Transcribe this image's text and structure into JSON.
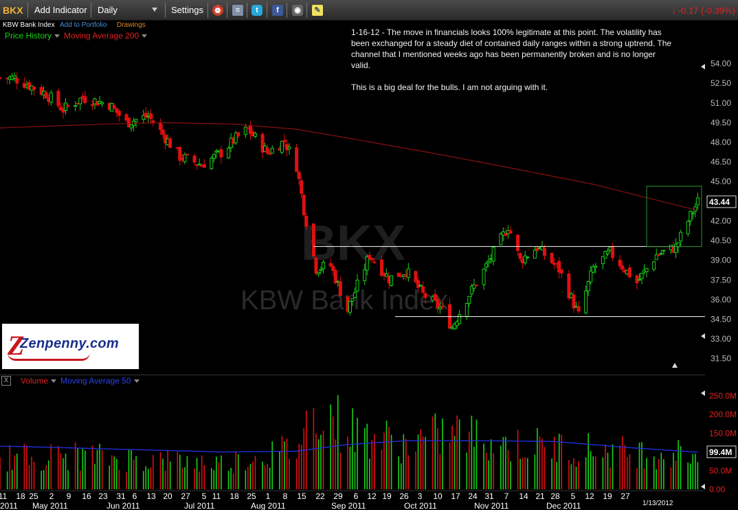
{
  "toolbar": {
    "symbol": "BKX",
    "add_indicator": "Add Indicator",
    "period": "Daily",
    "settings": "Settings",
    "change_arrow": "↓",
    "change": "-0.17 (-0.39%)",
    "icons": [
      "alarm-clock-icon",
      "database-icon",
      "twitter-icon",
      "facebook-icon",
      "camera-icon",
      "sticky-note-icon"
    ]
  },
  "subbar": {
    "name": "KBW Bank Index",
    "add_to_portfolio": "Add to Portfolio",
    "drawings": "Drawings"
  },
  "price_legend": {
    "price_history": "Price History",
    "moving_average": "Moving Average 200"
  },
  "volume_legend": {
    "close": "X",
    "volume": "Volume",
    "moving_average": "Moving Average 50"
  },
  "note": {
    "paragraph_1": "1-16-12 - The move in financials looks 100% legitimate at this point. The volatility has been exchanged for a steady diet of contained daily ranges within a strong uptrend. The channel that I mentioned weeks ago has been permanently broken and is no longer valid.",
    "paragraph_2": "This is a big deal for the bulls. I am not arguing with it."
  },
  "logo": {
    "text": "Zenpenny.com"
  },
  "watermark": {
    "symbol": "BKX",
    "name": "KBW Bank Index"
  },
  "colors": {
    "up": "#18d418",
    "down": "#e01010",
    "ma200": "#8a1010",
    "ma50": "#2030d8",
    "annotation_lines": "#ffffff",
    "highlight_box": "#2a9a2a",
    "symbol_accent": "#f2b233"
  },
  "chart_data": [
    {
      "type": "candlestick",
      "series": [
        {
          "name": "Price History"
        },
        {
          "name": "Moving Average 200"
        }
      ],
      "y_ticks": [
        "54.00",
        "52.50",
        "51.00",
        "49.50",
        "48.00",
        "46.50",
        "45.00",
        "43.44",
        "42.00",
        "40.50",
        "39.00",
        "37.50",
        "36.00",
        "34.50",
        "33.00",
        "31.50"
      ],
      "ylim": [
        30.75,
        55.5
      ],
      "last_price": 43.44,
      "x_ticks": [
        "11",
        "18",
        "25",
        "2",
        "9",
        "16",
        "23",
        "31",
        "6",
        "13",
        "20",
        "27",
        "5",
        "11",
        "18",
        "25",
        "1",
        "8",
        "15",
        "22",
        "29",
        "6",
        "12",
        "19",
        "26",
        "3",
        "10",
        "17",
        "24",
        "31",
        "7",
        "14",
        "21",
        "28",
        "5",
        "12",
        "19",
        "27"
      ],
      "month_labels": [
        "2011",
        "May 2011",
        "Jun 2011",
        "Jul 2011",
        "Aug 2011",
        "Sep 2011",
        "Oct 2011",
        "Nov 2011",
        "Dec 2011"
      ],
      "last_date": "1/13/2012",
      "support_level": 34.7,
      "resistance_level": 40.05,
      "close_path": [
        [
          "Apr 7 2011",
          52.9
        ],
        [
          "Apr 20 2011",
          51.7
        ],
        [
          "Apr 27 2011",
          50.5
        ],
        [
          "May 5 2011",
          51.4
        ],
        [
          "May 16 2011",
          50.9
        ],
        [
          "May 23 2011",
          49.5
        ],
        [
          "Jun 1 2011",
          50.0
        ],
        [
          "Jun 7 2011",
          48.6
        ],
        [
          "Jun 14 2011",
          46.9
        ],
        [
          "Jun 23 2011",
          46.3
        ],
        [
          "Jul 1 2011",
          47.2
        ],
        [
          "Jul 7 2011",
          48.3
        ],
        [
          "Jul 12 2011",
          49.0
        ],
        [
          "Jul 20 2011",
          47.2
        ],
        [
          "Jul 27 2011",
          48.1
        ],
        [
          "Aug 1 2011",
          46.2
        ],
        [
          "Aug 4 2011",
          42.9
        ],
        [
          "Aug 9 2011",
          38.4
        ],
        [
          "Aug 15 2011",
          38.6
        ],
        [
          "Aug 22 2011",
          35.2
        ],
        [
          "Aug 31 2011",
          39.4
        ],
        [
          "Sep 8 2011",
          37.6
        ],
        [
          "Sep 15 2011",
          38.2
        ],
        [
          "Sep 22 2011",
          36.4
        ],
        [
          "Sep 30 2011",
          35.2
        ],
        [
          "Oct 4 2011",
          33.9
        ],
        [
          "Oct 10 2011",
          36.1
        ],
        [
          "Oct 17 2011",
          38.2
        ],
        [
          "Oct 27 2011",
          41.6
        ],
        [
          "Nov 1 2011",
          39.0
        ],
        [
          "Nov 8 2011",
          40.0
        ],
        [
          "Nov 17 2011",
          38.3
        ],
        [
          "Nov 25 2011",
          34.8
        ],
        [
          "Dec 1 2011",
          38.4
        ],
        [
          "Dec 8 2011",
          39.6
        ],
        [
          "Dec 19 2011",
          37.3
        ],
        [
          "Dec 27 2011",
          39.4
        ],
        [
          "Jan 4 2012",
          40.0
        ],
        [
          "Jan 10 2012",
          42.4
        ],
        [
          "Jan 13 2012",
          43.44
        ]
      ],
      "ma_path": [
        [
          "Apr 1 2011",
          49.1
        ],
        [
          "May 16 2011",
          49.4
        ],
        [
          "Jun 7 2011",
          49.5
        ],
        [
          "Jul 5 2011",
          49.4
        ],
        [
          "Aug 1 2011",
          49.0
        ],
        [
          "Sep 1 2011",
          48.0
        ],
        [
          "Oct 1 2011",
          47.0
        ],
        [
          "Nov 1 2011",
          45.9
        ],
        [
          "Dec 1 2011",
          44.8
        ],
        [
          "Jan 13 2012",
          42.8
        ]
      ]
    },
    {
      "type": "bar",
      "series": [
        {
          "name": "Volume"
        },
        {
          "name": "Moving Average 50"
        }
      ],
      "y_ticks": [
        "250.0M",
        "200.0M",
        "150.0M",
        "99.4M",
        "50.0M",
        "0.00"
      ],
      "ylim": [
        0,
        270000000
      ],
      "last_volume": "99.4M",
      "volume_path": [
        [
          "Apr 7 2011",
          85
        ],
        [
          "May 1 2011",
          90
        ],
        [
          "Jun 1 2011",
          80
        ],
        [
          "Jul 1 2011",
          70
        ],
        [
          "Aug 1 2011",
          110
        ],
        [
          "Aug 9 2011",
          230
        ],
        [
          "Aug 22 2011",
          160
        ],
        [
          "Sep 15 2011",
          120
        ],
        [
          "Oct 4 2011",
          155
        ],
        [
          "Oct 28 2011",
          120
        ],
        [
          "Nov 25 2011",
          110
        ],
        [
          "Dec 15 2011",
          100
        ],
        [
          "Jan 13 2012",
          95
        ]
      ],
      "ma_path": [
        [
          "Apr 7 2011",
          115
        ],
        [
          "May 16 2011",
          108
        ],
        [
          "Jul 1 2011",
          100
        ],
        [
          "Aug 1 2011",
          102
        ],
        [
          "Aug 22 2011",
          120
        ],
        [
          "Sep 15 2011",
          130
        ],
        [
          "Oct 15 2011",
          130
        ],
        [
          "Nov 15 2011",
          128
        ],
        [
          "Dec 15 2011",
          112
        ],
        [
          "Jan 13 2012",
          99.4
        ]
      ]
    }
  ]
}
